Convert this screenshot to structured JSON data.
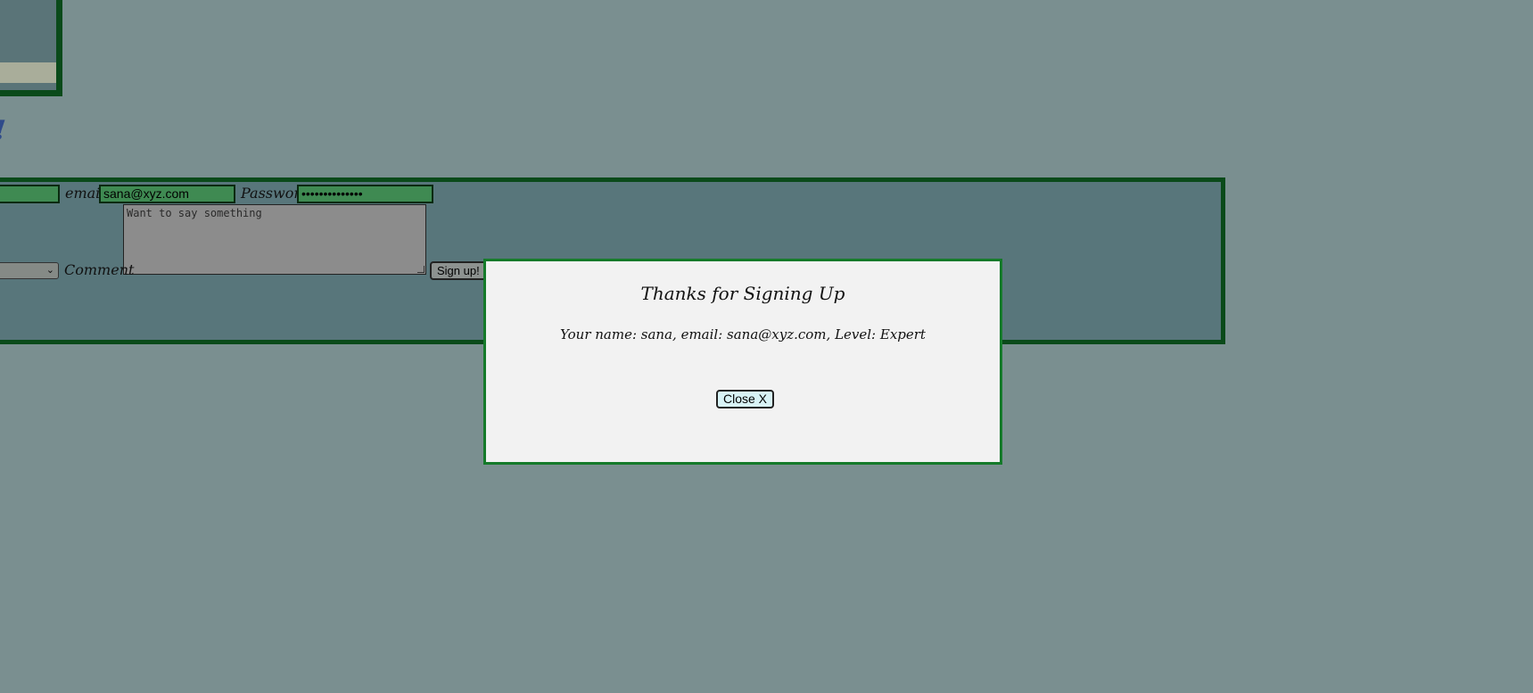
{
  "page": {
    "heading_fragment": "!"
  },
  "form": {
    "email_label": "email",
    "email_value": "sana@xyz.com",
    "password_label": "Password",
    "password_value": "••••••••••••••",
    "comment_label": "Comment",
    "comment_placeholder": "Want to say something",
    "select_chevron": "⌄",
    "submit_label": "Sign up!"
  },
  "modal": {
    "title": "Thanks for Signing Up",
    "message": "Your name: sana, email: sana@xyz.com, Level: Expert",
    "close_label": "Close X"
  },
  "colors": {
    "page_background": "#7a8f90",
    "panel_background": "#58767b",
    "panel_border": "#0a4a1a",
    "input_background": "#3f8a52",
    "modal_background": "#f2f2f2",
    "modal_border": "#157a2a",
    "close_button_background": "#d8f3f6",
    "heading_color": "#2e4a8a"
  }
}
